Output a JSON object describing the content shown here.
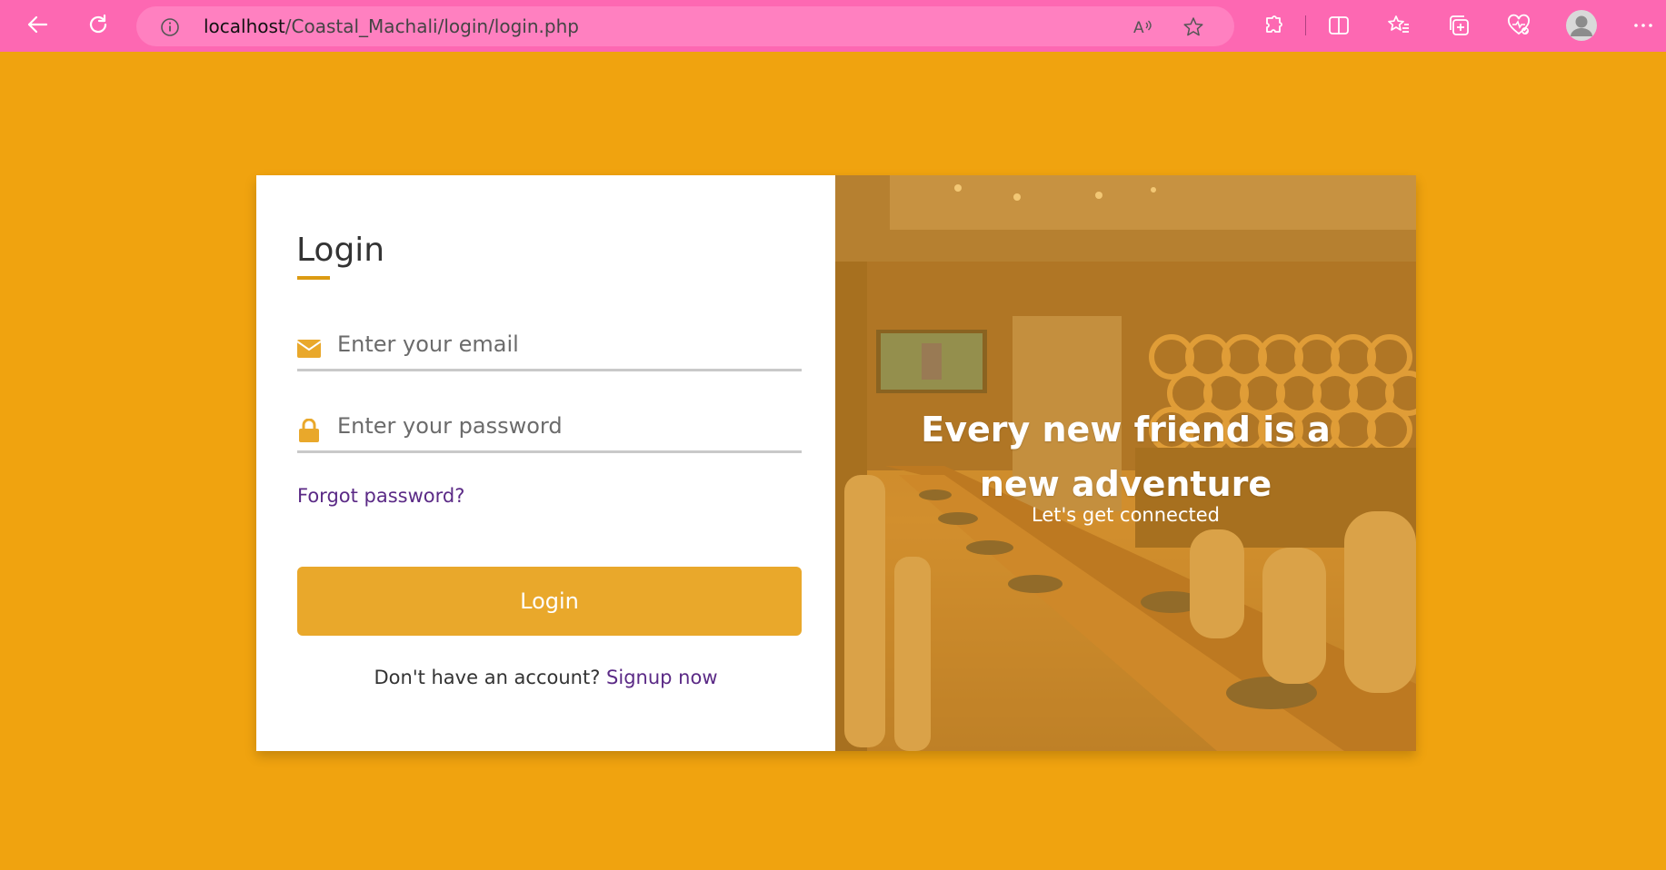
{
  "browser": {
    "url_host": "localhost",
    "url_path": "/Coastal_Machali/login/login.php",
    "icons": [
      "back-arrow-icon",
      "refresh-icon",
      "info-icon",
      "read-aloud-icon",
      "favorite-star-icon",
      "extensions-icon",
      "split-screen-icon",
      "favorites-icon",
      "collections-icon",
      "browser-essentials-icon",
      "profile-avatar-icon",
      "more-options-icon"
    ]
  },
  "login": {
    "title": "Login",
    "email_placeholder": "Enter your email",
    "password_placeholder": "Enter your password",
    "forgot_label": "Forgot password?",
    "button_label": "Login",
    "signup_prompt": "Don't have an account?",
    "signup_link": "Signup now"
  },
  "hero": {
    "tagline_line1": "Every new friend is a",
    "tagline_line2": "new adventure",
    "subline": "Let's get connected"
  },
  "colors": {
    "page_background": "#f0a30f",
    "browser_bar": "#fd68b2",
    "accent": "#e9a82b",
    "link": "#5b2a86"
  }
}
